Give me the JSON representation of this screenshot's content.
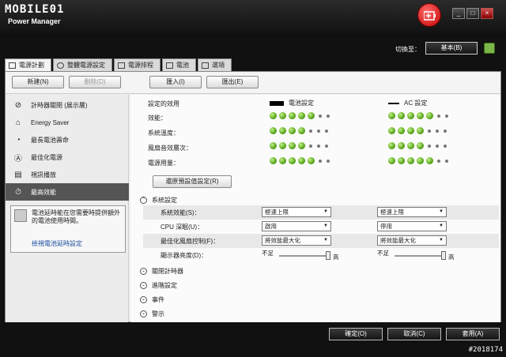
{
  "brand": "MOBILE01",
  "app_title": "Power Manager",
  "switch": {
    "label": "切換至：",
    "button": "基本(B)"
  },
  "tabs": [
    {
      "label": "電源計劃",
      "icon": "battery-plan-icon"
    },
    {
      "label": "整體電源設定",
      "icon": "gear-icon"
    },
    {
      "label": "電源排程",
      "icon": "calendar-icon"
    },
    {
      "label": "電池",
      "icon": "battery-icon"
    },
    {
      "label": "選項",
      "icon": "checkbox-icon"
    }
  ],
  "toolbar": {
    "new": "新建(N)",
    "delete": "刪除(D)",
    "import": "匯入(I)",
    "export": "匯出(E)"
  },
  "plans": [
    {
      "label": "計時器關閉 (展示層)",
      "icon": "timer-off-icon",
      "selected": false
    },
    {
      "label": "Energy Saver",
      "icon": "house-icon",
      "selected": false
    },
    {
      "label": "最長電池壽命",
      "icon": "battery-life-icon",
      "selected": false
    },
    {
      "label": "最佳化電源",
      "icon": "auto-icon",
      "selected": false
    },
    {
      "label": "視訊播放",
      "icon": "video-icon",
      "selected": false
    },
    {
      "label": "最高效能",
      "icon": "stopwatch-icon",
      "selected": true
    }
  ],
  "tip": {
    "text": "電池延時能在您需要時提供額外的電池使用時間。",
    "link": "檢視電池延時設定"
  },
  "headers": {
    "setting_effect": "設定的效用",
    "battery": "電池設定",
    "ac": "AC 設定"
  },
  "metrics": [
    {
      "label": "效能：",
      "battery": 5,
      "ac": 5
    },
    {
      "label": "系統溫度：",
      "battery": 4,
      "ac": 4
    },
    {
      "label": "風扇音效層次：",
      "battery": 4,
      "ac": 4
    },
    {
      "label": "電源用量：",
      "battery": 5,
      "ac": 5
    }
  ],
  "restore_button": "還原預設值設定(R)",
  "system_settings": {
    "title": "系統設定",
    "rows": [
      {
        "label": "系統效能(S)：",
        "battery": "極速上限",
        "ac": "極速上限"
      },
      {
        "label": "CPU 深眠(U)：",
        "battery": "啟用",
        "ac": "停用"
      },
      {
        "label": "最佳化風扇控制(F)：",
        "battery": "將效能最大化",
        "ac": "將效能最大化"
      }
    ],
    "brightness": {
      "label": "顯示器亮度(D)：",
      "low": "不足",
      "high": "高",
      "battery_level": 1.0,
      "ac_level": 1.0
    }
  },
  "sections": [
    "關閉計時器",
    "進階設定",
    "事件",
    "警示"
  ],
  "footer": {
    "ok": "確定(O)",
    "cancel": "取消(C)",
    "apply": "套用(A)"
  },
  "post_number": "#2018174"
}
